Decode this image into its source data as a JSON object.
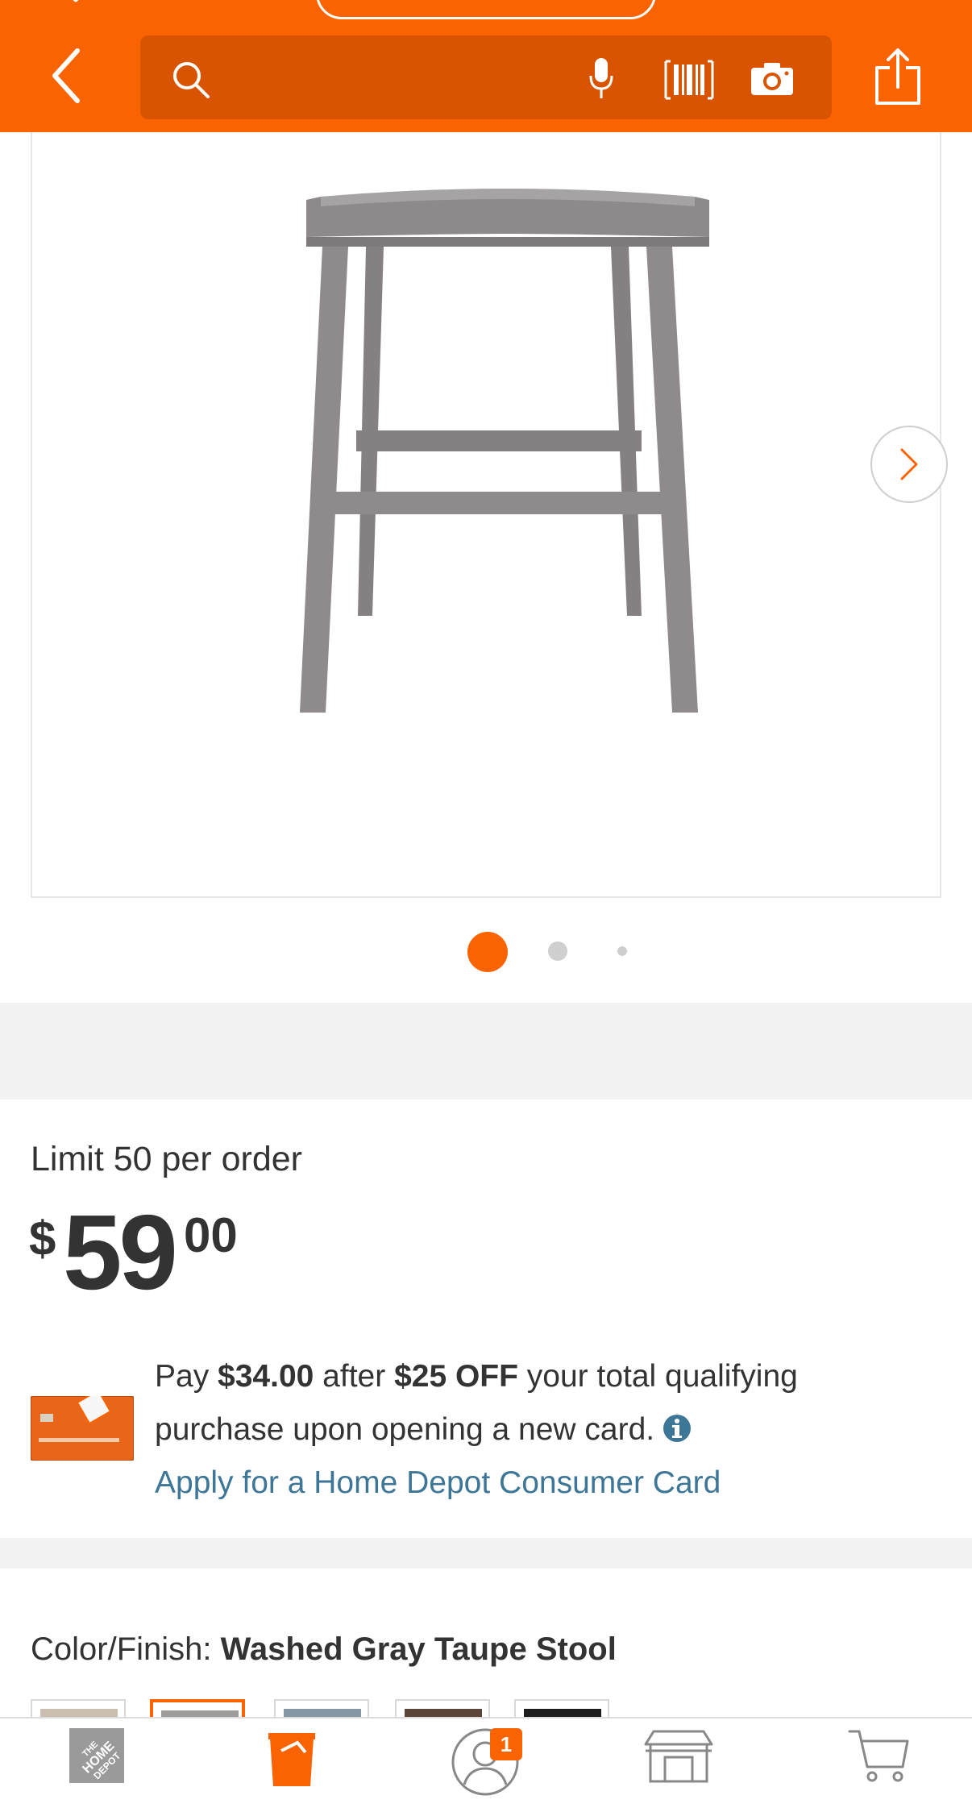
{
  "header": {
    "search_placeholder": "",
    "back_icon": "chevron-left-icon",
    "search_icon": "search-icon",
    "mic_icon": "microphone-icon",
    "barcode_icon": "barcode-icon",
    "camera_icon": "camera-icon",
    "share_icon": "share-icon",
    "brand_color": "#f96302"
  },
  "gallery": {
    "image_description": "stool-image",
    "next_icon": "chevron-right-icon",
    "page_count": 3,
    "active_page": 1
  },
  "price": {
    "limit_text": "Limit 50 per order",
    "currency": "$",
    "dollars": "59",
    "cents": "00"
  },
  "promo": {
    "line1_prefix": "Pay ",
    "line1_amount": "$34.00",
    "line1_mid": " after ",
    "line1_discount": "$25 OFF",
    "line1_suffix": " your total qualifying",
    "line2": "purchase upon opening a new card.",
    "apply_link": "Apply for a Home Depot Consumer Card"
  },
  "color_finish": {
    "label": "Color/Finish: ",
    "value": "Washed Gray Taupe Stool",
    "swatches": [
      {
        "color": "#cbbfb1",
        "selected": false
      },
      {
        "color": "#9f9b98",
        "selected": true
      },
      {
        "color": "#8597a3",
        "selected": false
      },
      {
        "color": "#5c463a",
        "selected": false
      },
      {
        "color": "#1c1c1c",
        "selected": false
      }
    ]
  },
  "bottom_nav": {
    "cart_badge": "1",
    "items": [
      {
        "label": "",
        "icon": "home-depot-logo-icon",
        "active": false
      },
      {
        "label": "",
        "icon": "shop-bucket-icon",
        "active": true
      },
      {
        "label": "",
        "icon": "account-icon",
        "active": false
      },
      {
        "label": "",
        "icon": "store-icon",
        "active": false
      },
      {
        "label": "",
        "icon": "cart-icon",
        "active": false
      }
    ]
  }
}
